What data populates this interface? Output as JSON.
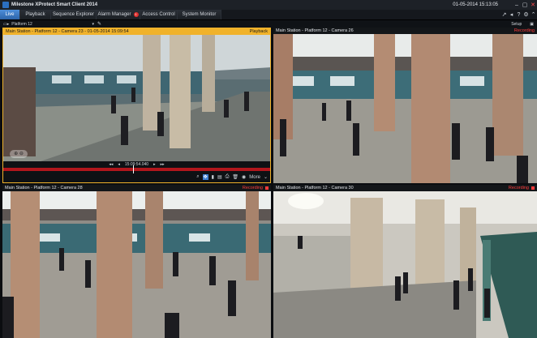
{
  "window": {
    "title": "Milestone XProtect Smart Client 2014",
    "clock": "01-05-2014 15:13:05"
  },
  "tabs": [
    {
      "label": "Live",
      "active": true
    },
    {
      "label": "Playback",
      "active": false
    },
    {
      "label": "Sequence Explorer",
      "active": false
    },
    {
      "label": "Alarm Manager",
      "active": false,
      "badge": "1"
    },
    {
      "label": "Access Control",
      "active": false
    },
    {
      "label": "System Monitor",
      "active": false
    }
  ],
  "toolbar": {
    "view_name": "Platform 12",
    "setup_label": "Setup"
  },
  "cameras": [
    {
      "name": "Main Station - Platform 12 - Camera 23 - 01-05-2014 15:09:54",
      "status": "Playback",
      "mode": "playback",
      "playback_time": "15:09:54.040",
      "more_label": "More"
    },
    {
      "name": "Main Station - Platform 12 - Camera 26",
      "status": "Recording",
      "mode": "live"
    },
    {
      "name": "Main Station - Platform 12 - Camera 28",
      "status": "Recording",
      "mode": "live"
    },
    {
      "name": "Main Station - Platform 12 - Camera 30",
      "status": "Recording",
      "mode": "live"
    }
  ],
  "colors": {
    "accent": "#3e7fcf",
    "playback": "#f0b22a",
    "recording": "#ff3b3b",
    "timeline": "#b1161c"
  },
  "icons": {
    "close": "close-icon",
    "minimize": "minimize-icon",
    "maximize": "maximize-icon",
    "settings": "gear-icon",
    "help": "help-icon"
  }
}
